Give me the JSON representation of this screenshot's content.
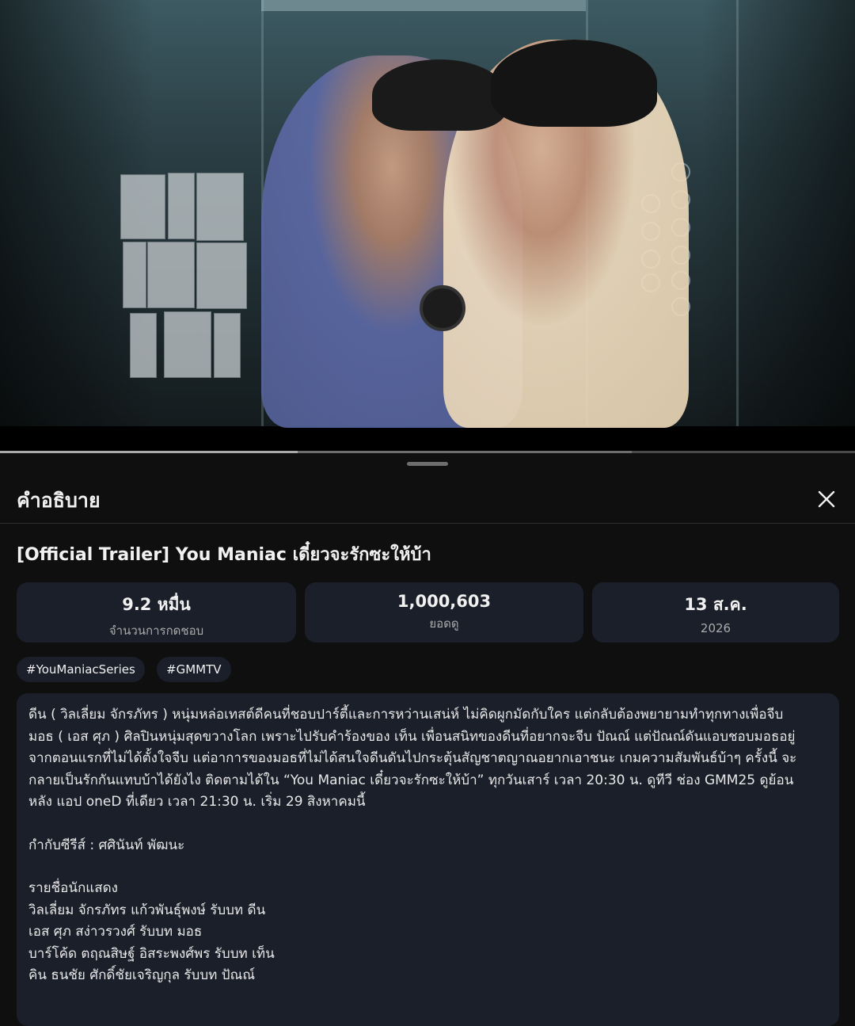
{
  "video": {
    "progress_played": 0.348,
    "progress_buffered": 0.739
  },
  "sheet": {
    "title": "คำอธิบาย",
    "close_icon": "close-icon"
  },
  "video_title": "[Official Trailer] You Maniac เดี๋ยวจะรักซะให้บ้า",
  "stats": [
    {
      "value": "9.2 หมื่น",
      "label": "จำนวนการกดชอบ"
    },
    {
      "value": "1,000,603",
      "label": "ยอดดู"
    },
    {
      "value": "13 ส.ค.",
      "label": "2026"
    }
  ],
  "hashtags": [
    "#YouManiacSeries",
    "#GMMTV"
  ],
  "description": {
    "lines": [
      "ดีน ( วิลเลี่ยม จักรภัทร ) หนุ่มหล่อเทสต์ดีคนที่ชอบปาร์ตี้และการหว่านเสน่ห์ ไม่คิดผูกมัดกับใคร แต่กลับต้องพยายามทำทุกทางเพื่อจีบ",
      "มอธ ( เอส ศุภ ) ศิลปินหนุ่มสุดขวางโลก เพราะไปรับคำร้องของ เท็น เพื่อนสนิทของดีนที่อยากจะจีบ ปัณณ์ แต่ปัณณ์ดันแอบชอบมอธอยู่",
      " จากตอนแรกที่ไม่ได้ตั้งใจจีบ แต่อาการของมอธที่ไม่ได้สนใจดีนดันไปกระตุ้นสัญชาตญาณอยากเอาชนะ เกมความสัมพันธ์บ้าๆ ครั้งนี้ จะ",
      "กลายเป็นรักกันแทบบ้าได้ยังไง ติดตามได้ใน “You Maniac เดี๋ยวจะรักซะให้บ้า” ทุกวันเสาร์ เวลา 20:30 น. ดูทีวี ช่อง GMM25 ดูย้อน",
      "หลัง แอป oneD ที่เดียว เวลา 21:30 น. เริ่ม 29 สิงหาคมนี้"
    ],
    "director": "กำกับซีรีส์ : ศศินันท์ พัฒนะ",
    "cast_heading": "รายชื่อนักแสดง",
    "cast": [
      "วิลเลี่ยม จักรภัทร แก้วพันธุ์พงษ์  รับบท ดีน",
      "เอส ศุภ สง่าวรวงศ์   รับบท มอธ",
      "บาร์โค้ด ตฤณสิษฐ์ อิสระพงศ์พร  รับบท เท็น",
      "คิน ธนชัย ศักดิ์ชัยเจริญกุล  รับบท ปัณณ์"
    ]
  }
}
